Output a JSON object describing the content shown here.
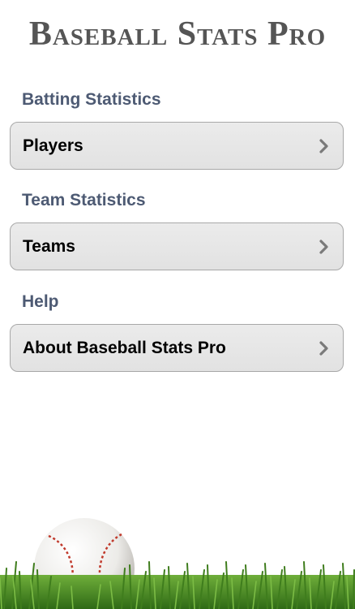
{
  "app": {
    "title": "Baseball Stats Pro"
  },
  "sections": [
    {
      "header": "Batting Statistics",
      "row_label": "Players",
      "icon": "chevron-right-icon"
    },
    {
      "header": "Team Statistics",
      "row_label": "Teams",
      "icon": "chevron-right-icon"
    },
    {
      "header": "Help",
      "row_label": "About Baseball Stats Pro",
      "icon": "chevron-right-icon"
    }
  ],
  "colors": {
    "section_header": "#4d5a73",
    "row_background": "#e6e6e6",
    "chevron": "#7a7a7a",
    "grass": "#4e8a26"
  },
  "decoration": {
    "image": "baseball-on-grass"
  }
}
